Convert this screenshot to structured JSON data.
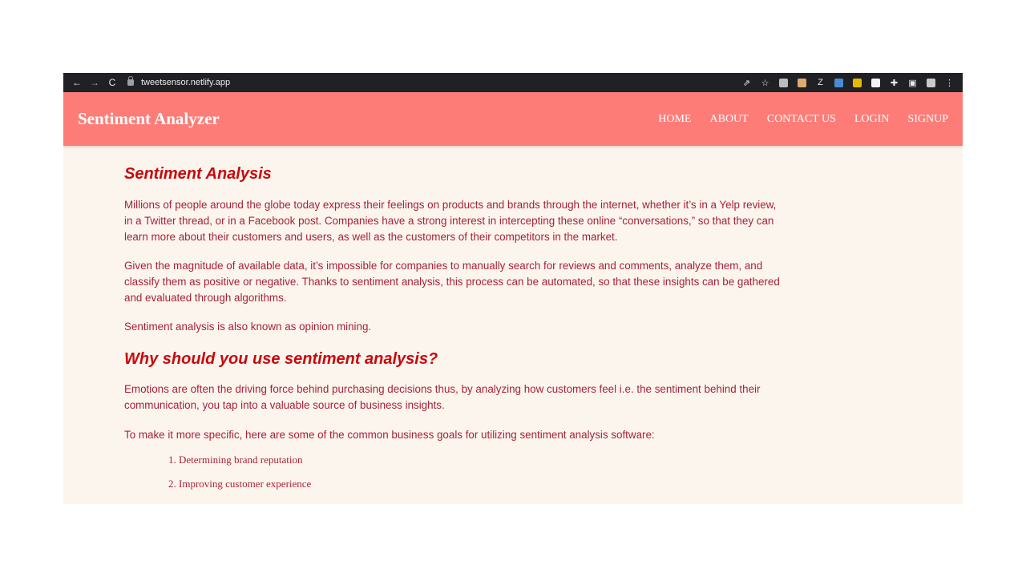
{
  "browser": {
    "url": "tweetsensor.netlify.app",
    "back_icon": "←",
    "forward_icon": "→",
    "reload_icon": "C",
    "share_icon": "⇗",
    "star_icon": "☆",
    "puzzle_icon": "✚",
    "panel_icon": "▣",
    "menu_icon": "⋮",
    "ext_z": "Z",
    "ext_colors": [
      "#bdbdbd",
      "#e0a96d",
      "#4a8bd8",
      "#e6b800",
      "#f2f2f2",
      "#c9c9c9"
    ]
  },
  "site": {
    "brand": "Sentiment Analyzer",
    "nav": [
      "HOME",
      "ABOUT",
      "CONTACT US",
      "LOGIN",
      "SIGNUP"
    ],
    "header_color": "#fd7c77",
    "background": "#fcf5ee"
  },
  "content": {
    "heading1": "Sentiment Analysis",
    "para1": "Millions of people around the globe today express their feelings on products and brands through the internet, whether it’s in a Yelp review, in a Twitter thread, or in a Facebook post. Companies have a strong interest in intercepting these online “conversations,” so that they can learn more about their customers and users, as well as the customers of their competitors in the market.",
    "para2": "Given the magnitude of available data, it’s impossible for companies to manually search for reviews and comments, analyze them, and classify them as positive or negative. Thanks to sentiment analysis, this process can be automated, so that these insights can be gathered and evaluated through algorithms.",
    "para3": "Sentiment analysis is also known as opinion mining.",
    "heading2": "Why should you use sentiment analysis?",
    "para4": "Emotions are often the driving force behind purchasing decisions thus, by analyzing how customers feel i.e. the sentiment behind their communication, you tap into a valuable source of business insights.",
    "para5": "To make it more specific, here are some of the common business goals for utilizing sentiment analysis software:",
    "goals": [
      "1. Determining brand reputation",
      "2. Improving customer experience"
    ]
  }
}
